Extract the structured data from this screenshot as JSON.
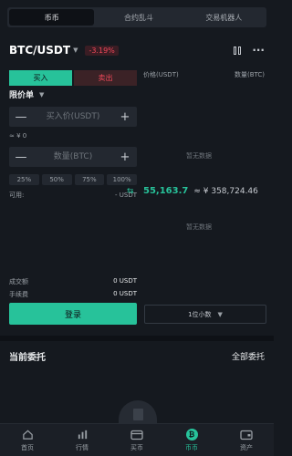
{
  "tabs": [
    {
      "label": "币币"
    },
    {
      "label": "合约乱斗"
    },
    {
      "label": "交易机器人"
    }
  ],
  "pair": {
    "symbol": "BTC/USDT",
    "change": "-3.19%"
  },
  "trade": {
    "buy_label": "买入",
    "sell_label": "卖出",
    "order_type": "限价单",
    "price_placeholder": "买入价(USDT)",
    "price_minus": "—",
    "price_plus": "+",
    "approx_value": "≈ ¥ 0",
    "amount_placeholder": "数量(BTC)",
    "amount_minus": "—",
    "amount_plus": "+",
    "percentages": [
      "25%",
      "50%",
      "75%",
      "100%"
    ],
    "available_label": "可用:",
    "available_value": "- USDT",
    "turnover_label": "成交额",
    "turnover_value": "0 USDT",
    "fee_label": "手续费",
    "fee_value": "0 USDT",
    "login_label": "登录"
  },
  "orderbook": {
    "price_header": "价格(USDT)",
    "amount_header": "数量(BTC)",
    "empty_asks": "暂无数据",
    "empty_bids": "暂无数据",
    "last_price": "55,163.7",
    "last_price_cny": "≈ ¥ 358,724.46",
    "decimals": "1位小数"
  },
  "orders": {
    "title": "当前委托",
    "all_label": "全部委托"
  },
  "bottom_nav": [
    {
      "label": "首页",
      "icon": "home-icon"
    },
    {
      "label": "行情",
      "icon": "market-chart-icon"
    },
    {
      "label": "买币",
      "icon": "card-icon"
    },
    {
      "label": "币币",
      "icon": "coin-icon",
      "active": true
    },
    {
      "label": "资产",
      "icon": "wallet-icon"
    }
  ],
  "colors": {
    "accent": "#27c29a",
    "negative": "#f0485a",
    "background": "#15191f"
  }
}
